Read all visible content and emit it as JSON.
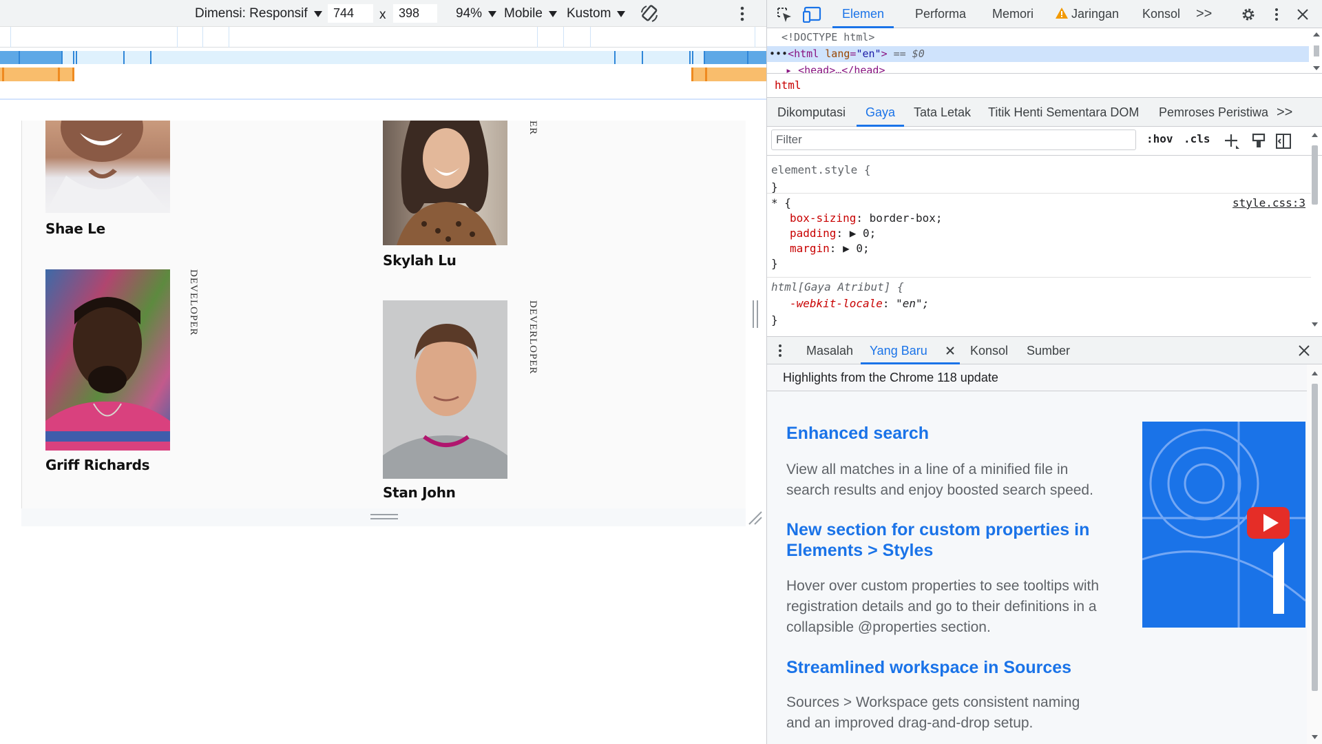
{
  "device_toolbar": {
    "dimension_label": "Dimensi: Responsif",
    "width_value": "744",
    "times": "x",
    "height_value": "398",
    "zoom": "94%",
    "device_type": "Mobile",
    "throttle": "Kustom"
  },
  "people": [
    {
      "name": "Shae Le",
      "role": ""
    },
    {
      "name": "Skylah Lu",
      "role": "ER"
    },
    {
      "name": "Griff Richards",
      "role": "DEVELOPER"
    },
    {
      "name": "Stan John",
      "role": "DEVERLOPER"
    }
  ],
  "devtools": {
    "tabs": [
      "Elemen",
      "Performa",
      "Memori",
      "Jaringan",
      "Konsol"
    ],
    "more": ">>",
    "dom": {
      "doctype": "<!DOCTYPE html>",
      "html_tag": "<html",
      "html_attr_name": "lang",
      "html_attr_value": "\"en\"",
      "html_close": ">",
      "selected_marker": "== $0",
      "head_line": "<head>…</head>"
    },
    "breadcrumb": "html",
    "style_tabs": [
      "Dikomputasi",
      "Gaya",
      "Tata Letak",
      "Titik Henti Sementara DOM",
      "Pemroses Peristiwa"
    ],
    "filter_placeholder": "Filter",
    "hov": ":hov",
    "cls": ".cls",
    "styles": {
      "element_style": "element.style {",
      "close": "}",
      "universal_selector": "* {",
      "source": "style.css:3",
      "decl1_prop": "box-sizing",
      "decl1_val": "border-box;",
      "decl2_prop": "padding",
      "decl2_val": "0;",
      "decl3_prop": "margin",
      "decl3_val": "0;",
      "attr_selector": "html[Gaya Atribut] {",
      "decl4_prop": "-webkit-locale",
      "decl4_val": "\"en\";"
    },
    "drawer_tabs": [
      "Masalah",
      "Yang Baru",
      "Konsol",
      "Sumber"
    ],
    "whatsnew_header": "Highlights from the Chrome 118 update",
    "whatsnew": [
      {
        "title": "Enhanced search",
        "body": "View all matches in a line of a minified file in search results and enjoy boosted search speed."
      },
      {
        "title": "New section for custom properties in Elements > Styles",
        "body": "Hover over custom properties to see tooltips with registration details and go to their definitions in a collapsible @properties section."
      },
      {
        "title": "Streamlined workspace in Sources",
        "body": "Sources > Workspace gets consistent naming and an improved drag-and-drop setup."
      }
    ]
  },
  "colors": {
    "accent": "#1a73e8",
    "warning": "#f29900",
    "tag": "#881280",
    "attr": "#994500",
    "prop": "#c80000"
  }
}
